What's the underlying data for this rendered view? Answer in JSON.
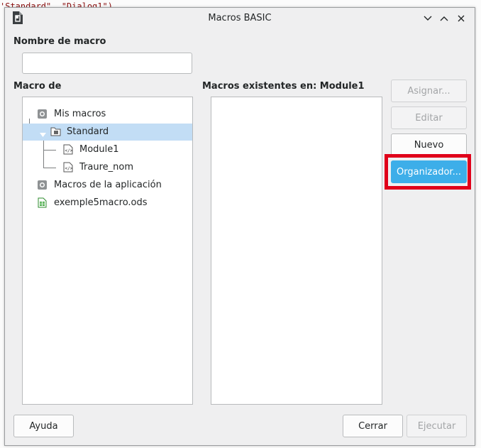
{
  "background": {
    "code_fragments": [
      "'Standard\", \"Dialog1\")"
    ]
  },
  "dialog": {
    "title": "Macros BASIC",
    "window_controls": {
      "minimize_icon": "chevron-down-icon",
      "maximize_icon": "chevron-up-icon",
      "close_icon": "close-icon"
    },
    "macro_name_label": "Nombre de macro",
    "macro_name_value": "",
    "macro_from_label": "Macro de",
    "existing_macros_label": "Macros existentes en: Module1",
    "tree": [
      {
        "label": "Mis macros",
        "icon": "library-icon",
        "level": 0
      },
      {
        "label": "Standard",
        "icon": "folder-icon",
        "level": 1,
        "selected": true,
        "expanded": true
      },
      {
        "label": "Module1",
        "icon": "basic-module-icon",
        "level": 2
      },
      {
        "label": "Traure_nom",
        "icon": "basic-module-icon",
        "level": 2
      },
      {
        "label": "Macros de la aplicación",
        "icon": "library-icon",
        "level": 0
      },
      {
        "label": "exemple5macro.ods",
        "icon": "spreadsheet-icon",
        "level": 0
      }
    ],
    "existing_macros": [],
    "buttons": {
      "assign": "Asignar...",
      "edit": "Editar",
      "new": "Nuevo",
      "organizer": "Organizador...",
      "help": "Ayuda",
      "close": "Cerrar",
      "run": "Ejecutar"
    },
    "colors": {
      "accent": "#3daee9",
      "highlight_border": "#e0001a",
      "selection": "#c2ddf5"
    }
  }
}
